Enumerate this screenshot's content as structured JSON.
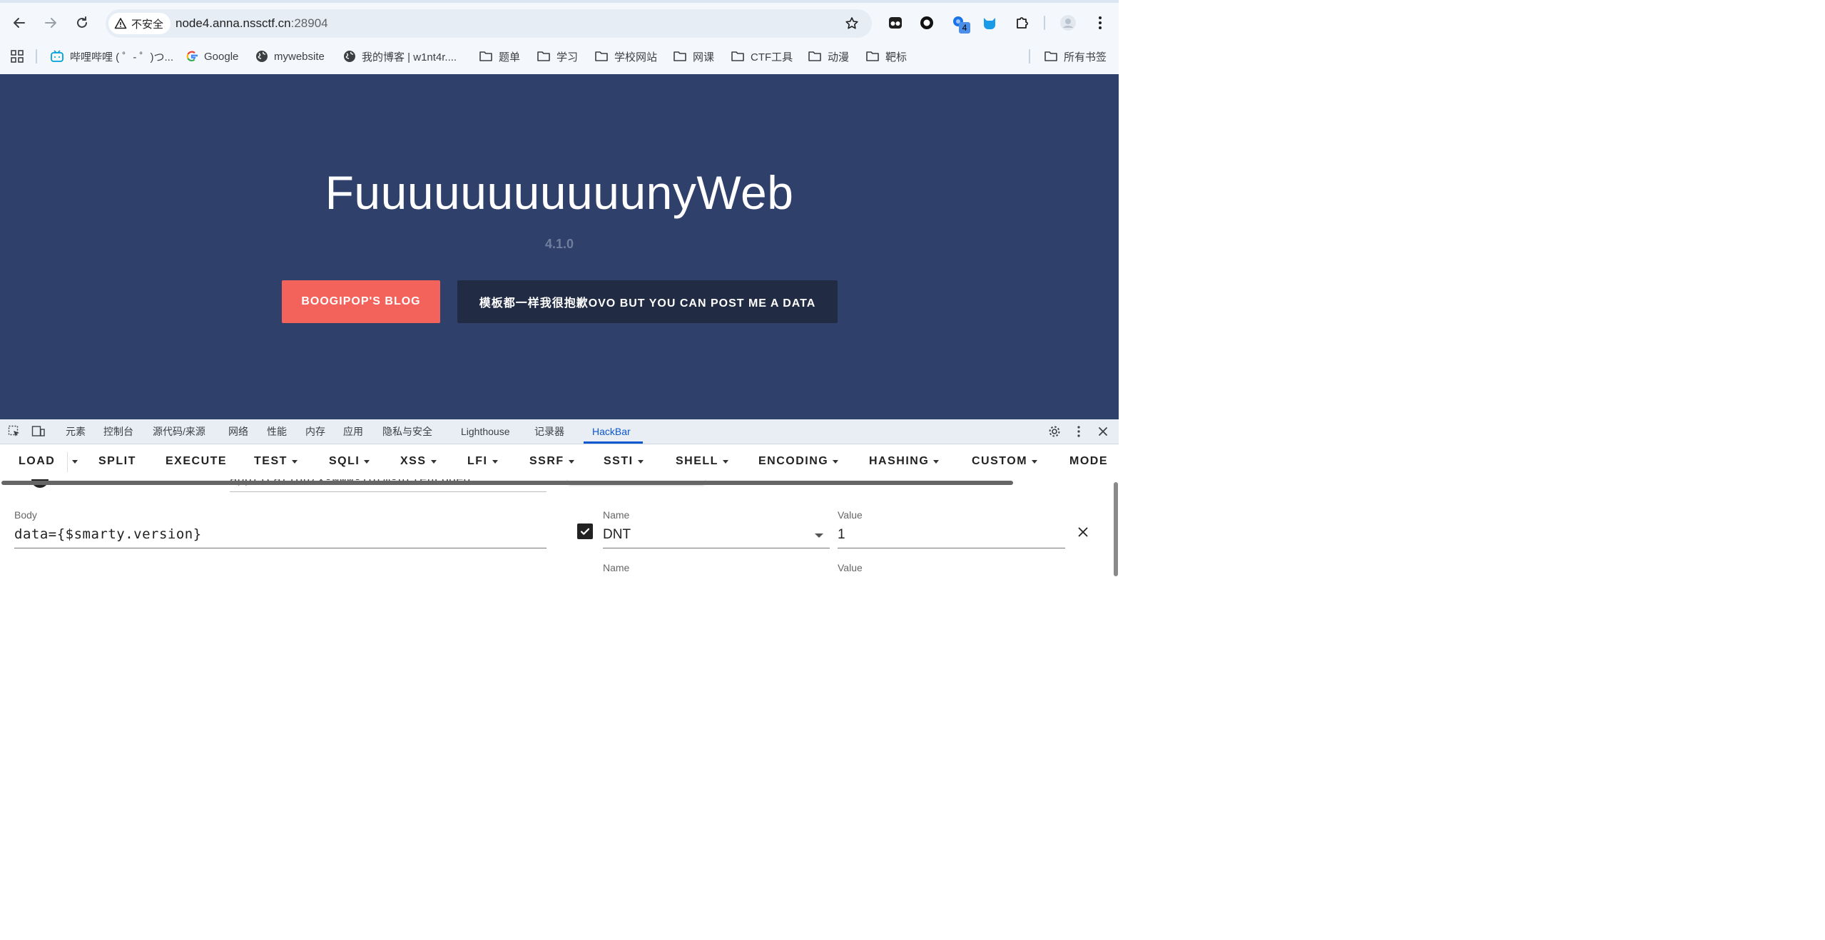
{
  "browser": {
    "security_label": "不安全",
    "url_host": "node4.anna.nssctf.cn",
    "url_port": ":28904",
    "extension_badge": "4"
  },
  "bookmarks": [
    {
      "label": "哔哩哔哩 ( ゜- ゜)つ...",
      "icon": "bilibili-icon"
    },
    {
      "label": "Google",
      "icon": "google-icon"
    },
    {
      "label": "mywebsite",
      "icon": "globe-icon"
    },
    {
      "label": "我的博客 | w1nt4r....",
      "icon": "globe-icon"
    },
    {
      "label": "题单",
      "icon": "folder-icon"
    },
    {
      "label": "学习",
      "icon": "folder-icon"
    },
    {
      "label": "学校网站",
      "icon": "folder-icon"
    },
    {
      "label": "网课",
      "icon": "folder-icon"
    },
    {
      "label": "CTF工具",
      "icon": "folder-icon"
    },
    {
      "label": "动漫",
      "icon": "folder-icon"
    },
    {
      "label": "靶标",
      "icon": "folder-icon"
    }
  ],
  "all_bookmarks_label": "所有书签",
  "page": {
    "title": "FuuuuuuuuuuunyWeb",
    "version": "4.1.0",
    "blog_button": "BOOGIPOP'S BLOG",
    "post_button": "模板都一样我很抱歉OVO BUT YOU CAN POST ME A DATA"
  },
  "devtools": {
    "tabs": [
      "元素",
      "控制台",
      "源代码/来源",
      "网络",
      "性能",
      "内存",
      "应用",
      "隐私与安全",
      "Lighthouse",
      "记录器",
      "HackBar"
    ],
    "active_tab": "HackBar"
  },
  "hackbar": {
    "toolbar": [
      "LOAD",
      "SPLIT",
      "EXECUTE",
      "TEST",
      "SQLI",
      "XSS",
      "LFI",
      "SSRF",
      "SSTI",
      "SHELL",
      "ENCODING",
      "HASHING",
      "CUSTOM",
      "MODE"
    ],
    "content_type_value": "application/x-www-form-urlencoded",
    "body_label": "Body",
    "body_value": "data={$smarty.version}",
    "header_name_label": "Name",
    "header_value_label": "Value",
    "header_name": "DNT",
    "header_value": "1",
    "header_enabled": true,
    "next_name_label": "Name",
    "next_value_label": "Value"
  },
  "colors": {
    "page_bg": "#2f416b",
    "blog_button": "#f3635b",
    "post_button": "#222b44",
    "devtools_accent": "#0b57d0"
  }
}
